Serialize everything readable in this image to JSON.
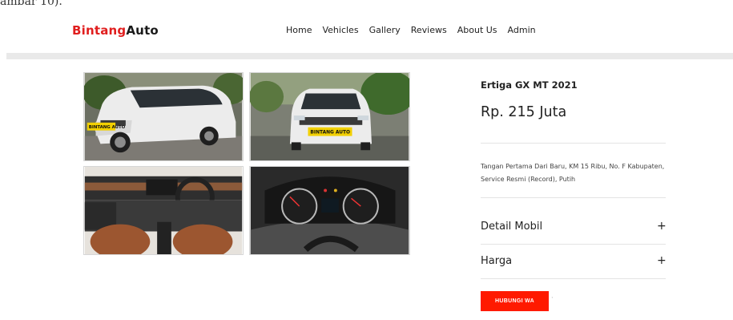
{
  "caption": "ambar 10).",
  "brand": {
    "part1": "Bintang",
    "part2": "Auto",
    "accent_color": "#e01e1e"
  },
  "nav": [
    "Home",
    "Vehicles",
    "Gallery",
    "Reviews",
    "About Us",
    "Admin"
  ],
  "gallery": {
    "images": [
      {
        "icon": "car-front-side-photo",
        "badge": "BINTANG AUTO"
      },
      {
        "icon": "car-front-photo",
        "badge": "BINTANG AUTO"
      },
      {
        "icon": "car-interior-dashboard-photo"
      },
      {
        "icon": "instrument-cluster-photo"
      }
    ]
  },
  "listing": {
    "title": "Ertiga GX MT 2021",
    "price": "Rp. 215 Juta",
    "description": "Tangan Pertama Dari Baru, KM 15 Ribu, No. F Kabupaten, Service Resmi (Record), Putih",
    "accordions": [
      {
        "label": "Detail Mobil",
        "icon": "+"
      },
      {
        "label": "Harga",
        "icon": "+"
      }
    ],
    "cta_label": "HUBUNGI WA",
    "cta_color": "#ff1a00"
  }
}
